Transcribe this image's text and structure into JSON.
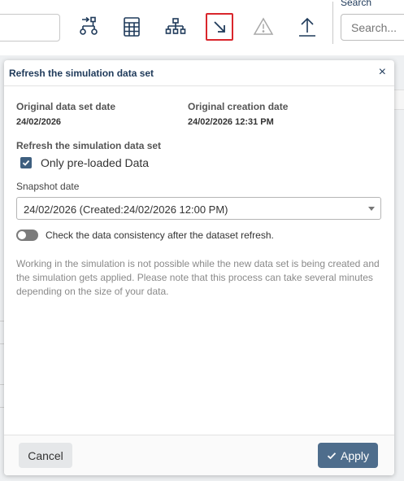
{
  "toolbar": {
    "icons": [
      "hierarchy-arrow-icon",
      "calculator-icon",
      "org-chart-icon",
      "arrow-down-right-icon",
      "warning-icon",
      "upload-icon"
    ],
    "search_label": "Search",
    "search_placeholder": "Search..."
  },
  "dialog": {
    "title": "Refresh the simulation data set",
    "close_glyph": "×",
    "original_date_label": "Original data set date",
    "original_date_value": "24/02/2026",
    "creation_date_label": "Original creation date",
    "creation_date_value": "24/02/2026 12:31 PM",
    "refresh_section_label": "Refresh the simulation data set",
    "checkbox_label": "Only pre-loaded Data",
    "checkbox_checked": true,
    "snapshot_label": "Snapshot date",
    "snapshot_value": "24/02/2026 (Created:24/02/2026 12:00 PM)",
    "toggle_label": "Check the data consistency after the dataset refresh.",
    "toggle_on": false,
    "info_text": "Working in the simulation is not possible while the new data set is being created and the simulation gets applied. Please note that this process can take several minutes depending on the size of your data.",
    "cancel_label": "Cancel",
    "apply_label": "Apply"
  },
  "colors": {
    "accent": "#4e6d8c",
    "title": "#1f3a5a",
    "active_outline": "#d9262c"
  }
}
